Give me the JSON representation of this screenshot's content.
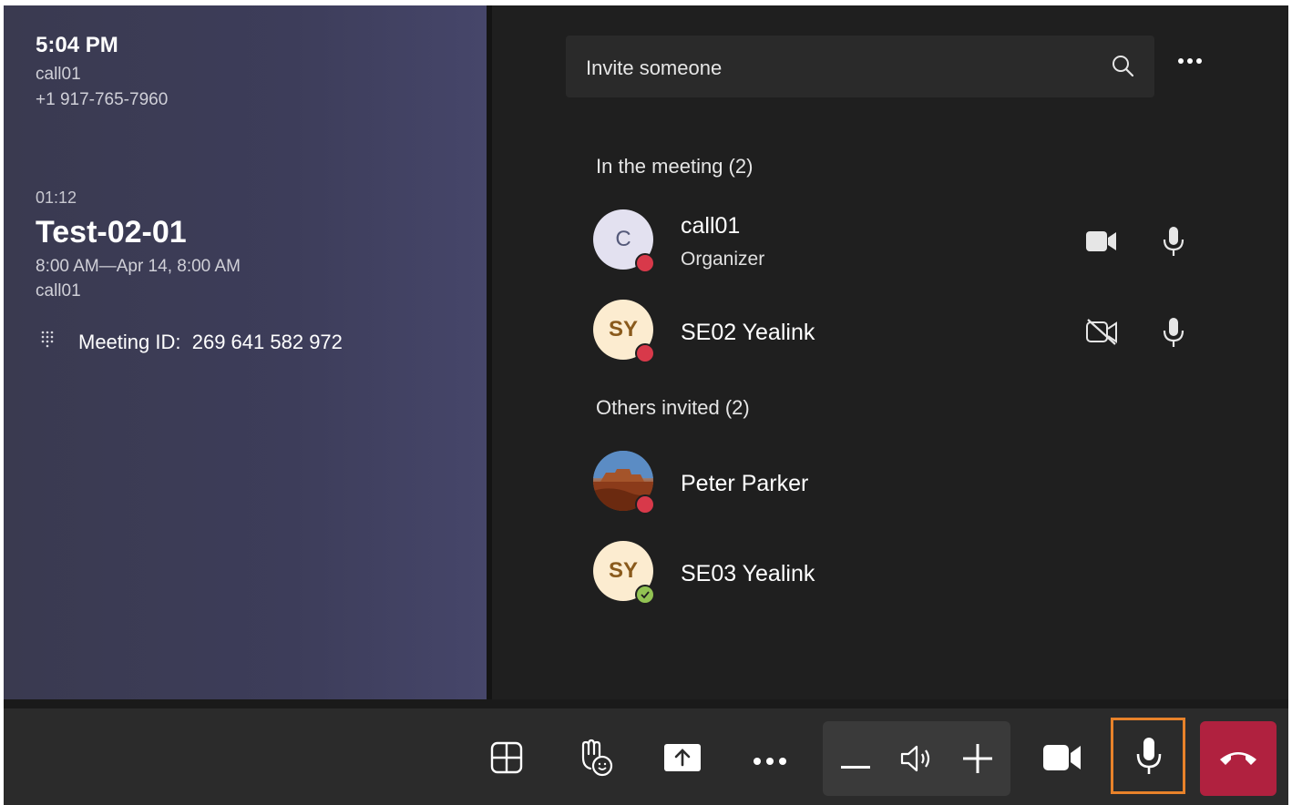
{
  "left": {
    "time": "5:04 PM",
    "account": "call01",
    "phone": "+1 917-765-7960",
    "duration": "01:12",
    "meeting_title": "Test-02-01",
    "meeting_time": "8:00 AM—Apr 14, 8:00 AM",
    "organizer": "call01",
    "meeting_id_label": "Meeting ID:",
    "meeting_id": "269 641 582 972"
  },
  "invite": {
    "placeholder": "Invite someone"
  },
  "sections": {
    "in_meeting": "In the meeting (2)",
    "others_invited": "Others invited (2)"
  },
  "participants": [
    {
      "initials": "C",
      "name": "call01",
      "role": "Organizer",
      "status": "busy",
      "video": "on",
      "mic": "on"
    },
    {
      "initials": "SY",
      "name": "SE02 Yealink",
      "role": "",
      "status": "busy",
      "video": "off",
      "mic": "on"
    }
  ],
  "invited": [
    {
      "initials": "",
      "name": "Peter Parker",
      "status": "busy",
      "avatar": "photo"
    },
    {
      "initials": "SY",
      "name": "SE03 Yealink",
      "status": "available",
      "avatar": "initials"
    }
  ],
  "toolbar": {
    "icons": [
      "layout-icon",
      "raise-hand-icon",
      "share-icon",
      "more-icon",
      "volume-down-icon",
      "speaker-icon",
      "volume-up-icon",
      "camera-icon",
      "microphone-icon",
      "hang-up-icon"
    ],
    "hangup_color": "#b0213f",
    "focus_color": "#e8822a"
  }
}
